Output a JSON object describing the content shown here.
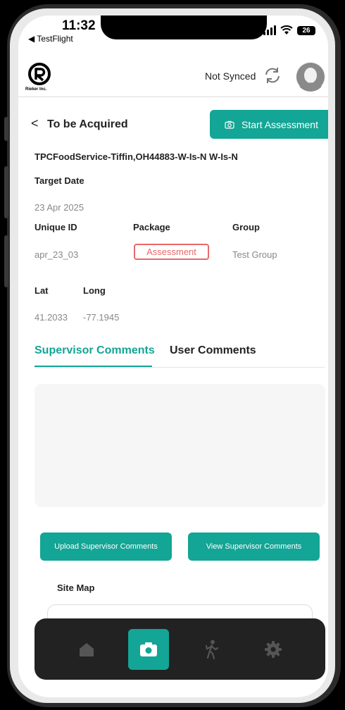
{
  "status_bar": {
    "time": "11:32",
    "back_app": "◀ TestFlight",
    "battery": "26"
  },
  "header": {
    "logo_caption": "Rieker Inc.",
    "sync_status": "Not Synced"
  },
  "page": {
    "back_symbol": "<",
    "title": "To be Acquired",
    "start_button": "Start Assessment",
    "site_name": "TPCFoodService-Tiffin,OH44883-W-Is-N W-Is-N"
  },
  "details": {
    "target_date_label": "Target Date",
    "target_date": "23 Apr 2025",
    "unique_id_label": "Unique ID",
    "unique_id": "apr_23_03",
    "package_label": "Package",
    "package": "Assessment",
    "group_label": "Group",
    "group": "Test Group",
    "lat_label": "Lat",
    "lat": "41.2033",
    "long_label": "Long",
    "long": "-77.1945"
  },
  "tabs": {
    "supervisor": "Supervisor Comments",
    "user": "User Comments"
  },
  "actions": {
    "upload": "Upload Supervisor Comments",
    "view": "View Supervisor Comments"
  },
  "site_map": {
    "label": "Site Map"
  },
  "colors": {
    "accent": "#13a595",
    "badge": "#e86a6a",
    "nav_bg": "#222222"
  },
  "nav": {
    "items": [
      "home-icon",
      "camera-icon",
      "walking-person-icon",
      "gear-icon"
    ],
    "active": "camera-icon"
  }
}
